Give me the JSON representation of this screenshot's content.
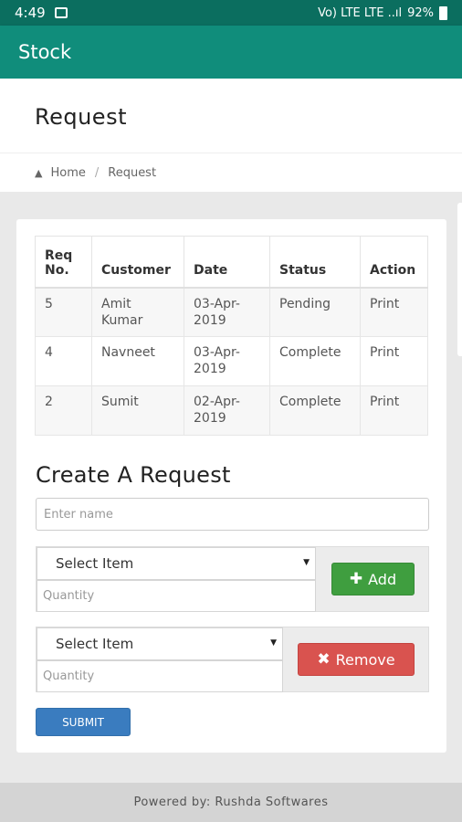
{
  "status_bar": {
    "time": "4:49",
    "signal_text": "Vo) LTE LTE ..ıl",
    "battery": "92%"
  },
  "app_bar": {
    "title": "Stock"
  },
  "page": {
    "title": "Request"
  },
  "breadcrumb": {
    "home": "Home",
    "separator": "/",
    "current": "Request"
  },
  "table": {
    "headers": [
      "Req No.",
      "Customer",
      "Date",
      "Status",
      "Action"
    ],
    "rows": [
      {
        "req_no": "5",
        "customer": "Amit Kumar",
        "date": "03-Apr-2019",
        "status": "Pending",
        "action": "Print"
      },
      {
        "req_no": "4",
        "customer": "Navneet",
        "date": "03-Apr-2019",
        "status": "Complete",
        "action": "Print"
      },
      {
        "req_no": "2",
        "customer": "Sumit",
        "date": "02-Apr-2019",
        "status": "Complete",
        "action": "Print"
      }
    ]
  },
  "form": {
    "title": "Create A Request",
    "name_placeholder": "Enter name",
    "items": [
      {
        "select": "Select Item",
        "qty_placeholder": "Quantity",
        "button": "Add"
      },
      {
        "select": "Select Item",
        "qty_placeholder": "Quantity",
        "button": "Remove"
      }
    ],
    "submit": "SUBMIT"
  },
  "footer": {
    "text": "Powered by: Rushda Softwares"
  },
  "colors": {
    "app_bar": "#108d7b",
    "add": "#3f9e3f",
    "remove": "#d9534f",
    "submit": "#3a7cbf"
  }
}
